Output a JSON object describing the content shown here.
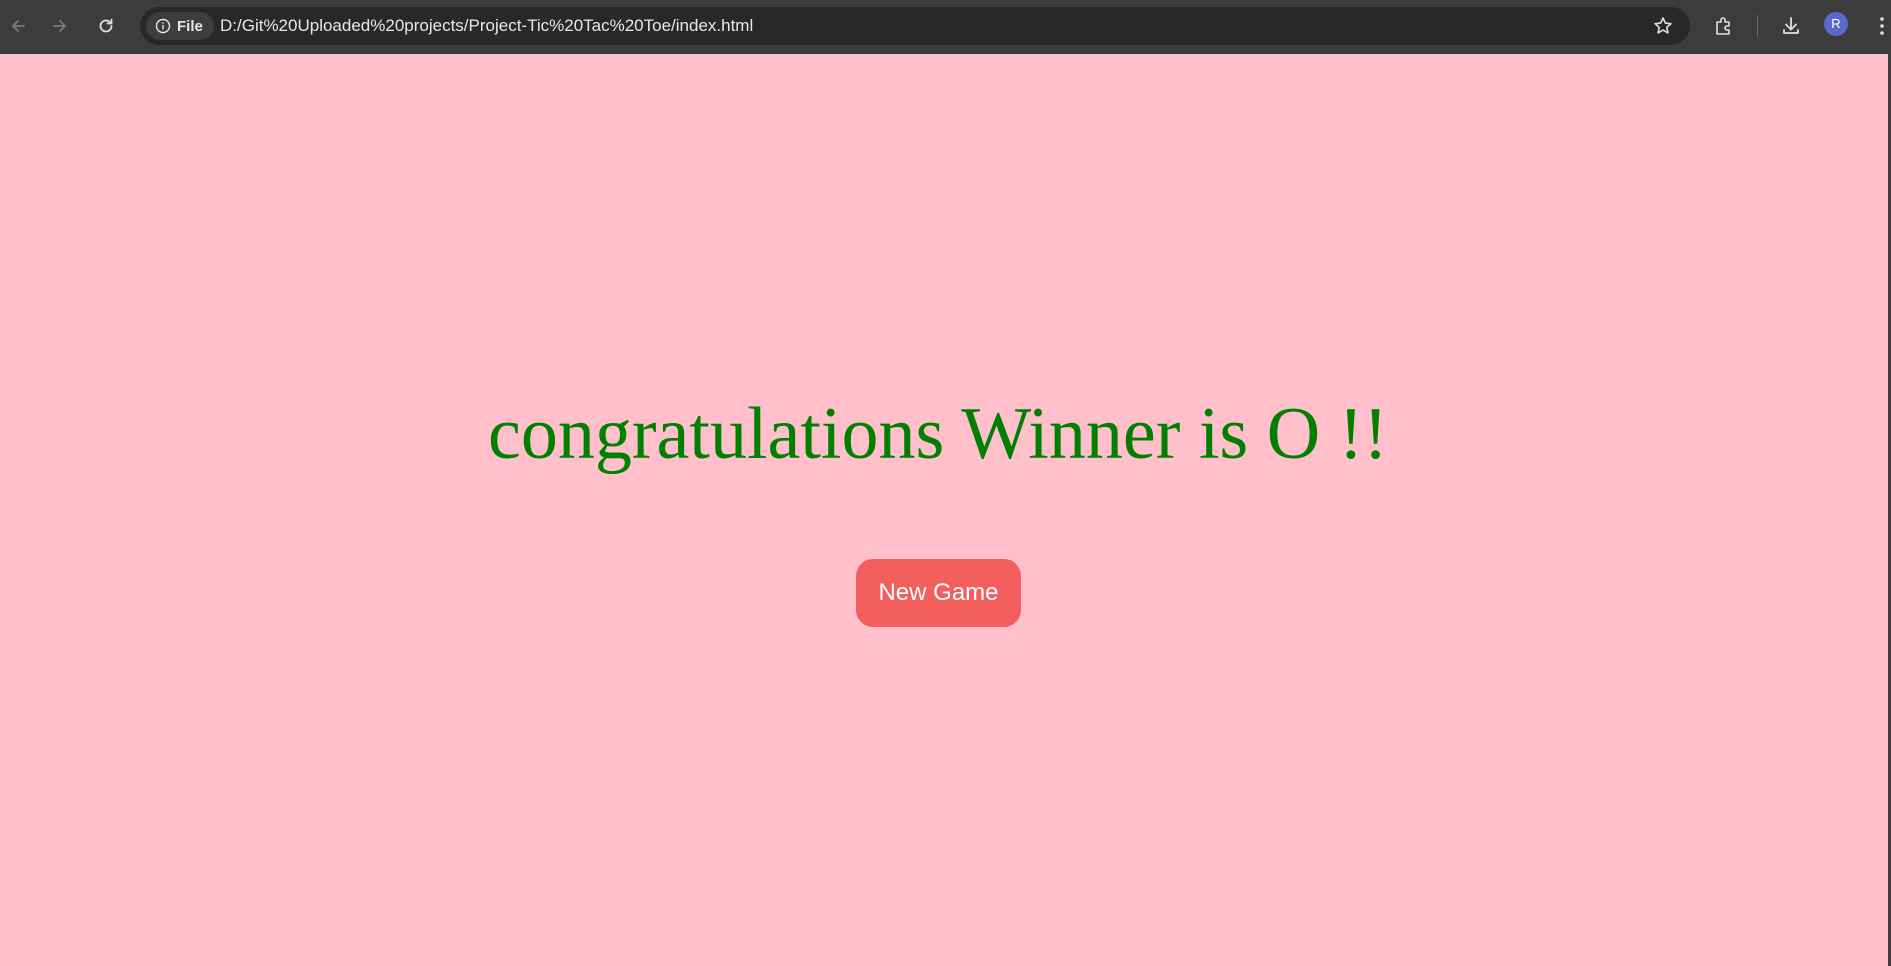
{
  "browser": {
    "address_chip_label": "File",
    "url": "D:/Git%20Uploaded%20projects/Project-Tic%20Tac%20Toe/index.html",
    "avatar_initial": "R",
    "icons": {
      "back": "back-arrow-icon",
      "forward": "forward-arrow-icon",
      "reload": "reload-icon",
      "site_info": "info-icon",
      "bookmark": "star-icon",
      "extensions": "puzzle-icon",
      "downloads": "download-icon",
      "menu": "kebab-menu-icon"
    },
    "colors": {
      "toolbar_bg": "#3c3c3c",
      "omnibox_bg": "#282828",
      "avatar_bg": "#5b6ac9"
    }
  },
  "game": {
    "winner_message": "congratulations Winner is O !!",
    "new_game_label": "New Game",
    "colors": {
      "page_bg": "#ffc0cb",
      "message_color": "#008000",
      "button_bg": "#f25f5c",
      "button_text": "#ffffff"
    }
  }
}
